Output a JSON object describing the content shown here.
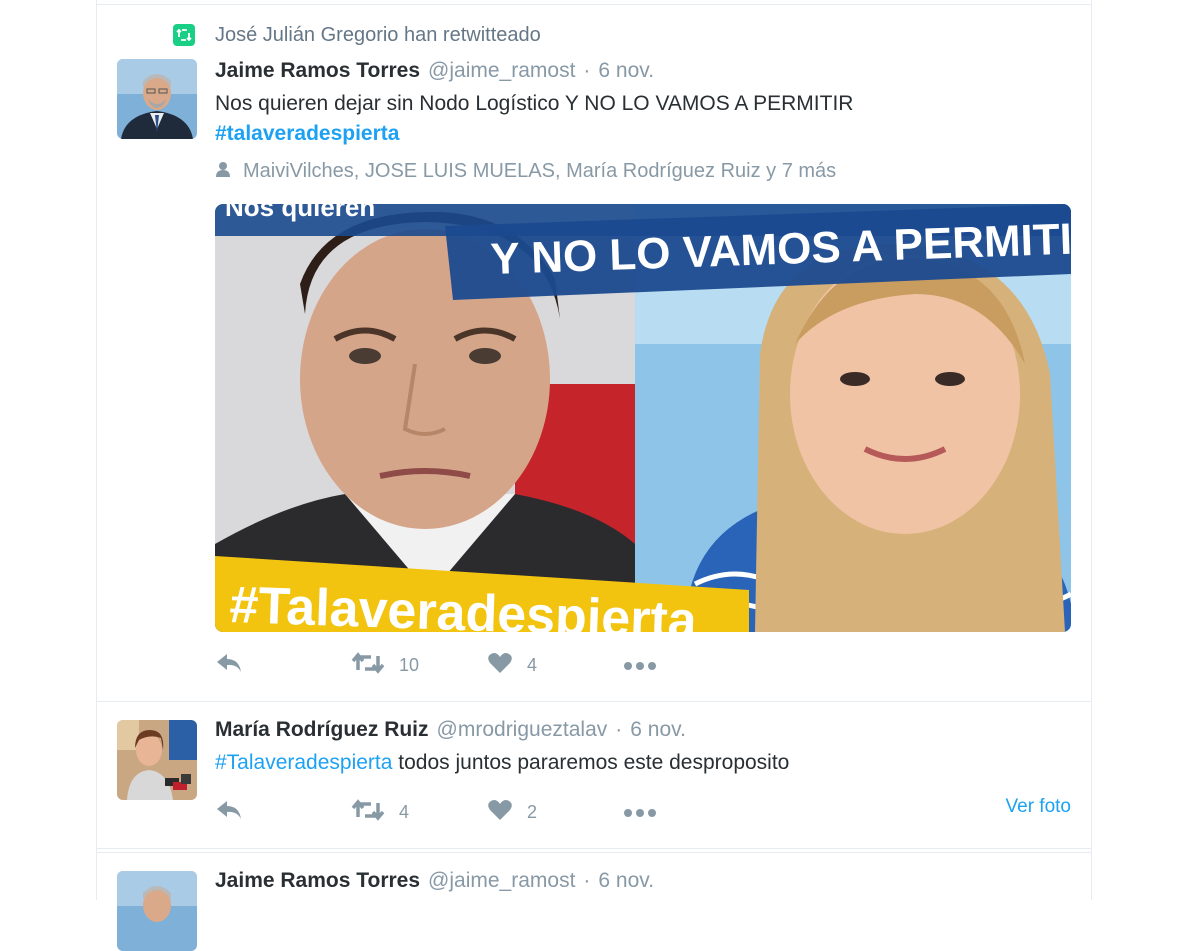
{
  "retweet_context": {
    "text": "José Julián Gregorio han retwitteado"
  },
  "tweets": [
    {
      "fullname": "Jaime Ramos Torres",
      "username": "@jaime_ramost",
      "dot": "·",
      "time": "6 nov.",
      "text": "Nos quieren dejar sin Nodo Logístico Y NO LO VAMOS A PERMITIR",
      "hashtag": "#talaveradespierta",
      "social_proof": "MaiviVilches, JOSE LUIS MUELAS, María Rodríguez Ruiz y 7 más",
      "media": {
        "banner_top_partial": "Nos quieren",
        "banner_main": "Y NO LO VAMOS A PERMITIR",
        "banner_hashtag": "#Talaveradespierta"
      },
      "retweet_count": "10",
      "like_count": "4"
    },
    {
      "fullname": "María Rodríguez Ruiz",
      "username": "@mrodrigueztalav",
      "dot": "·",
      "time": "6 nov.",
      "hashtag": "#Talaveradespierta",
      "text": "todos juntos pararemos este desproposito",
      "retweet_count": "4",
      "like_count": "2",
      "view_photo": "Ver foto"
    },
    {
      "fullname": "Jaime Ramos Torres",
      "username": "@jaime_ramost",
      "dot": "·",
      "time": "6 nov."
    }
  ],
  "colors": {
    "link": "#1da1f2",
    "muted": "#8899a6",
    "retweet_badge": "#19cf86",
    "banner_blue": "#1b4a8f",
    "banner_yellow": "#f2c40f"
  },
  "icons": [
    "retweet-context-icon",
    "person-icon",
    "reply-icon",
    "retweet-icon",
    "like-icon",
    "more-icon"
  ]
}
